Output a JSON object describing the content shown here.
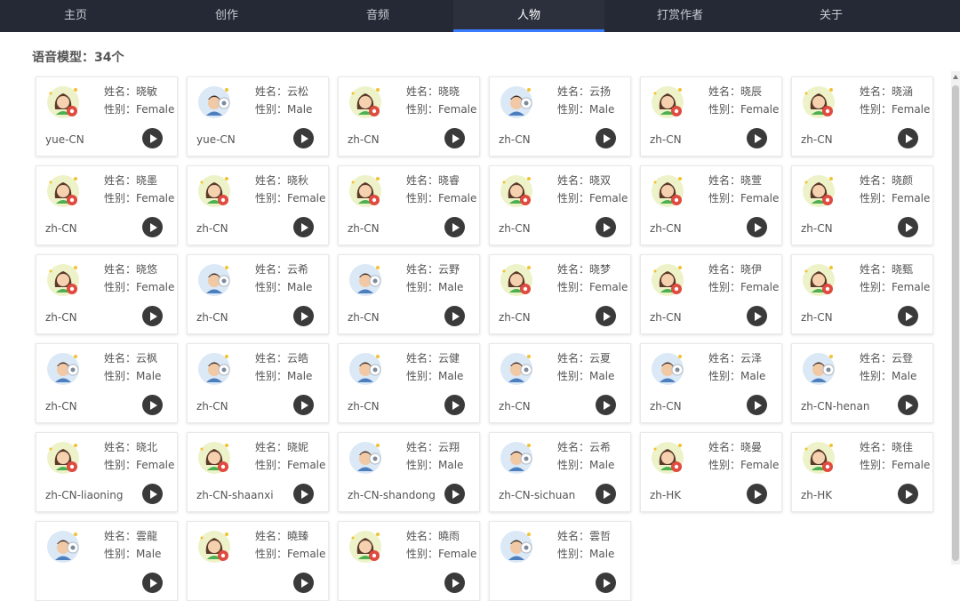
{
  "nav": {
    "tabs": [
      {
        "label": "主页"
      },
      {
        "label": "创作"
      },
      {
        "label": "音频"
      },
      {
        "label": "人物",
        "active": true
      },
      {
        "label": "打赏作者"
      },
      {
        "label": "关于"
      }
    ]
  },
  "section": {
    "title": "语音模型：34个"
  },
  "voices": [
    {
      "name": "姓名：晓敏",
      "gender": "性别：Female",
      "locale": "yue-CN",
      "avatar": "female"
    },
    {
      "name": "姓名：云松",
      "gender": "性别：Male",
      "locale": "yue-CN",
      "avatar": "male"
    },
    {
      "name": "姓名：晓晓",
      "gender": "性别：Female",
      "locale": "zh-CN",
      "avatar": "female"
    },
    {
      "name": "姓名：云扬",
      "gender": "性别：Male",
      "locale": "zh-CN",
      "avatar": "male"
    },
    {
      "name": "姓名：晓辰",
      "gender": "性别：Female",
      "locale": "zh-CN",
      "avatar": "female"
    },
    {
      "name": "姓名：晓涵",
      "gender": "性别：Female",
      "locale": "zh-CN",
      "avatar": "female"
    },
    {
      "name": "姓名：晓墨",
      "gender": "性别：Female",
      "locale": "zh-CN",
      "avatar": "female"
    },
    {
      "name": "姓名：晓秋",
      "gender": "性别：Female",
      "locale": "zh-CN",
      "avatar": "female"
    },
    {
      "name": "姓名：晓睿",
      "gender": "性别：Female",
      "locale": "zh-CN",
      "avatar": "female"
    },
    {
      "name": "姓名：晓双",
      "gender": "性别：Female",
      "locale": "zh-CN",
      "avatar": "female"
    },
    {
      "name": "姓名：晓萱",
      "gender": "性别：Female",
      "locale": "zh-CN",
      "avatar": "female"
    },
    {
      "name": "姓名：晓颜",
      "gender": "性别：Female",
      "locale": "zh-CN",
      "avatar": "female"
    },
    {
      "name": "姓名：晓悠",
      "gender": "性别：Female",
      "locale": "zh-CN",
      "avatar": "female"
    },
    {
      "name": "姓名：云希",
      "gender": "性别：Male",
      "locale": "zh-CN",
      "avatar": "male"
    },
    {
      "name": "姓名：云野",
      "gender": "性别：Male",
      "locale": "zh-CN",
      "avatar": "male"
    },
    {
      "name": "姓名：晓梦",
      "gender": "性别：Female",
      "locale": "zh-CN",
      "avatar": "female"
    },
    {
      "name": "姓名：晓伊",
      "gender": "性别：Female",
      "locale": "zh-CN",
      "avatar": "female"
    },
    {
      "name": "姓名：晓甄",
      "gender": "性别：Female",
      "locale": "zh-CN",
      "avatar": "female"
    },
    {
      "name": "姓名：云枫",
      "gender": "性别：Male",
      "locale": "zh-CN",
      "avatar": "male"
    },
    {
      "name": "姓名：云皓",
      "gender": "性别：Male",
      "locale": "zh-CN",
      "avatar": "male"
    },
    {
      "name": "姓名：云健",
      "gender": "性别：Male",
      "locale": "zh-CN",
      "avatar": "male"
    },
    {
      "name": "姓名：云夏",
      "gender": "性别：Male",
      "locale": "zh-CN",
      "avatar": "male"
    },
    {
      "name": "姓名：云泽",
      "gender": "性别：Male",
      "locale": "zh-CN",
      "avatar": "male"
    },
    {
      "name": "姓名：云登",
      "gender": "性别：Male",
      "locale": "zh-CN-henan",
      "avatar": "male"
    },
    {
      "name": "姓名：晓北",
      "gender": "性别：Female",
      "locale": "zh-CN-liaoning",
      "avatar": "female"
    },
    {
      "name": "姓名：晓妮",
      "gender": "性别：Female",
      "locale": "zh-CN-shaanxi",
      "avatar": "female"
    },
    {
      "name": "姓名：云翔",
      "gender": "性别：Male",
      "locale": "zh-CN-shandong",
      "avatar": "male"
    },
    {
      "name": "姓名：云希",
      "gender": "性别：Male",
      "locale": "zh-CN-sichuan",
      "avatar": "male"
    },
    {
      "name": "姓名：晓曼",
      "gender": "性别：Female",
      "locale": "zh-HK",
      "avatar": "female"
    },
    {
      "name": "姓名：晓佳",
      "gender": "性别：Female",
      "locale": "zh-HK",
      "avatar": "female"
    },
    {
      "name": "姓名：雲龍",
      "gender": "性别：Male",
      "locale": "",
      "avatar": "male"
    },
    {
      "name": "姓名：曉臻",
      "gender": "性别：Female",
      "locale": "",
      "avatar": "female"
    },
    {
      "name": "姓名：曉雨",
      "gender": "性别：Female",
      "locale": "",
      "avatar": "female"
    },
    {
      "name": "姓名：雲哲",
      "gender": "性别：Male",
      "locale": "",
      "avatar": "male"
    }
  ],
  "colors": {
    "nav_bg": "#242935",
    "nav_active_bg": "#2b303c",
    "nav_accent": "#3a7bff",
    "play_button": "#3a3a3a"
  }
}
